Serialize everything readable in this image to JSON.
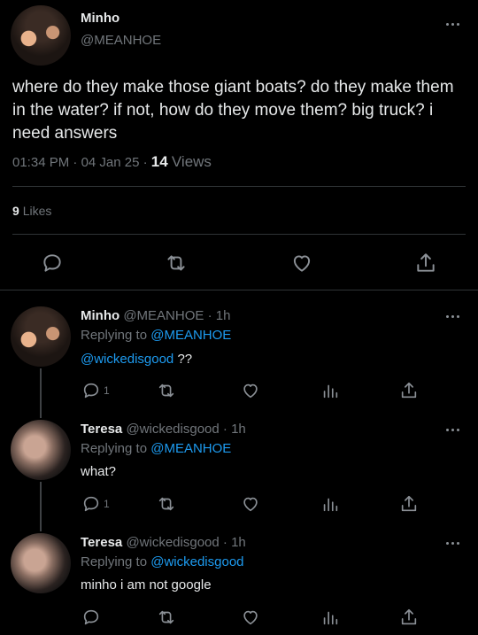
{
  "main_post": {
    "display_name": "Minho",
    "handle": "@MEANHOE",
    "text": "where do they make those giant boats? do they make them in the water? if not, how do they move them? big truck? i need answers",
    "time": "01:34 PM",
    "date": "04 Jan 25",
    "views_count": "14",
    "views_label": "Views",
    "likes_count": "9",
    "likes_label": "Likes"
  },
  "replies": [
    {
      "display_name": "Minho",
      "handle": "@MEANHOE",
      "age": "1h",
      "replying_prefix": "Replying to",
      "replying_to": "@MEANHOE",
      "mention": "@wickedisgood",
      "text": " ??",
      "reply_count": "1"
    },
    {
      "display_name": "Teresa",
      "handle": "@wickedisgood",
      "age": "1h",
      "replying_prefix": "Replying to",
      "replying_to": "@MEANHOE",
      "text": "what?",
      "reply_count": "1"
    },
    {
      "display_name": "Teresa",
      "handle": "@wickedisgood",
      "age": "1h",
      "replying_prefix": "Replying to",
      "replying_to": "@wickedisgood",
      "text": "minho i am not google",
      "reply_count": ""
    }
  ],
  "icons": {
    "reply": "reply-icon",
    "retweet": "retweet-icon",
    "like": "heart-icon",
    "share": "share-icon",
    "views": "views-chart-icon",
    "more": "more-icon"
  },
  "colors": {
    "background": "#000000",
    "text": "#e7e9ea",
    "muted": "#71767b",
    "link": "#1d9bf0",
    "divider": "#2f3336"
  }
}
